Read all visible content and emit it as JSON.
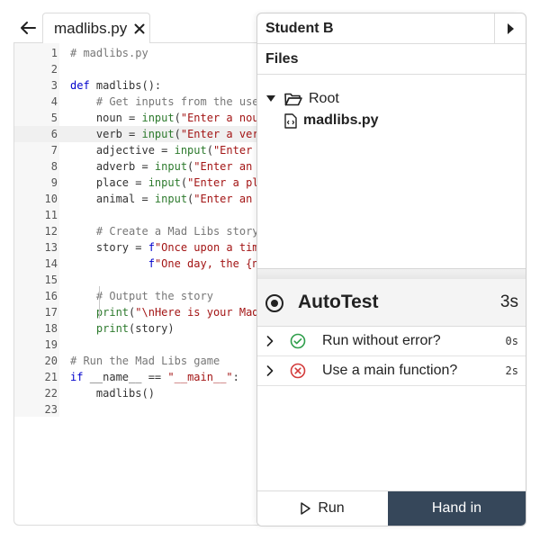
{
  "tab": {
    "filename": "madlibs.py"
  },
  "editor": {
    "lines": [
      {
        "n": "1",
        "tokens": [
          [
            "c",
            "# madlibs.py"
          ]
        ]
      },
      {
        "n": "2",
        "tokens": []
      },
      {
        "n": "3",
        "tokens": [
          [
            "k",
            "def "
          ],
          [
            "f",
            "madlibs"
          ],
          [
            "p",
            "():"
          ]
        ]
      },
      {
        "n": "4",
        "tokens": [
          [
            "p",
            "    "
          ],
          [
            "c",
            "# Get inputs from the use"
          ]
        ]
      },
      {
        "n": "5",
        "tokens": [
          [
            "p",
            "    noun = "
          ],
          [
            "b",
            "input"
          ],
          [
            "p",
            "("
          ],
          [
            "s",
            "\"Enter a nou"
          ]
        ]
      },
      {
        "n": "6",
        "tokens": [
          [
            "p",
            "    verb = "
          ],
          [
            "b",
            "input"
          ],
          [
            "p",
            "("
          ],
          [
            "s",
            "\"Enter a ver"
          ]
        ],
        "active": true
      },
      {
        "n": "7",
        "tokens": [
          [
            "p",
            "    adjective = "
          ],
          [
            "b",
            "input"
          ],
          [
            "p",
            "("
          ],
          [
            "s",
            "\"Enter "
          ]
        ]
      },
      {
        "n": "8",
        "tokens": [
          [
            "p",
            "    adverb = "
          ],
          [
            "b",
            "input"
          ],
          [
            "p",
            "("
          ],
          [
            "s",
            "\"Enter an "
          ]
        ]
      },
      {
        "n": "9",
        "tokens": [
          [
            "p",
            "    place = "
          ],
          [
            "b",
            "input"
          ],
          [
            "p",
            "("
          ],
          [
            "s",
            "\"Enter a pl"
          ]
        ]
      },
      {
        "n": "10",
        "tokens": [
          [
            "p",
            "    animal = "
          ],
          [
            "b",
            "input"
          ],
          [
            "p",
            "("
          ],
          [
            "s",
            "\"Enter an "
          ]
        ]
      },
      {
        "n": "11",
        "tokens": []
      },
      {
        "n": "12",
        "tokens": [
          [
            "p",
            "    "
          ],
          [
            "c",
            "# Create a Mad Libs story"
          ]
        ]
      },
      {
        "n": "13",
        "tokens": [
          [
            "p",
            "    story = "
          ],
          [
            "k",
            "f"
          ],
          [
            "s",
            "\"Once upon a tim"
          ]
        ]
      },
      {
        "n": "14",
        "tokens": [
          [
            "p",
            "            "
          ],
          [
            "k",
            "f"
          ],
          [
            "s",
            "\"One day, the {n"
          ]
        ]
      },
      {
        "n": "15",
        "tokens": []
      },
      {
        "n": "16",
        "tokens": [
          [
            "p",
            "    "
          ],
          [
            "c",
            "# Output the story"
          ]
        ]
      },
      {
        "n": "17",
        "tokens": [
          [
            "p",
            "    "
          ],
          [
            "b",
            "print"
          ],
          [
            "p",
            "("
          ],
          [
            "s",
            "\"\\nHere is your Mad"
          ]
        ]
      },
      {
        "n": "18",
        "tokens": [
          [
            "p",
            "    "
          ],
          [
            "b",
            "print"
          ],
          [
            "p",
            "(story)"
          ]
        ]
      },
      {
        "n": "19",
        "tokens": []
      },
      {
        "n": "20",
        "tokens": [
          [
            "c",
            "# Run the Mad Libs game"
          ]
        ]
      },
      {
        "n": "21",
        "tokens": [
          [
            "k",
            "if "
          ],
          [
            "p",
            "__name__ == "
          ],
          [
            "s",
            "\"__main__\""
          ],
          [
            "p",
            ":"
          ]
        ]
      },
      {
        "n": "22",
        "tokens": [
          [
            "p",
            "    madlibs()"
          ]
        ]
      },
      {
        "n": "23",
        "tokens": []
      }
    ]
  },
  "panel": {
    "title": "Student B",
    "files_label": "Files",
    "root_label": "Root",
    "file_label": "madlibs.py"
  },
  "autotest": {
    "title": "AutoTest",
    "time": "3s",
    "tests": [
      {
        "label": "Run without error?",
        "time": "0s",
        "status": "pass"
      },
      {
        "label": "Use a main function?",
        "time": "2s",
        "status": "fail"
      }
    ]
  },
  "footer": {
    "run_label": "Run",
    "handin_label": "Hand in"
  },
  "colors": {
    "pass": "#2e9e4a",
    "fail": "#d33a3a",
    "handin_bg": "#36475a"
  }
}
